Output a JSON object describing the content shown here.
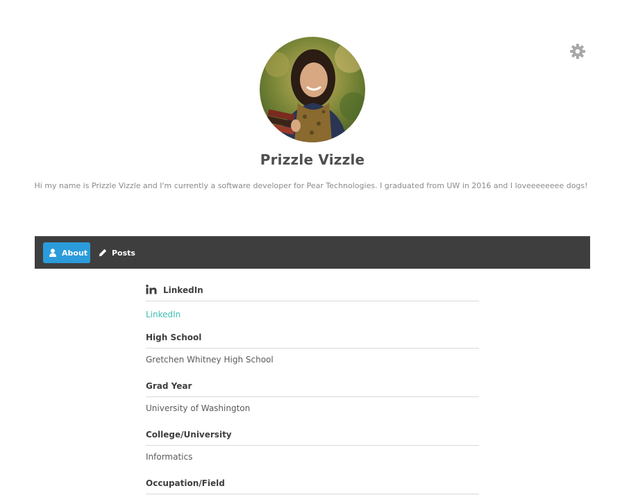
{
  "profile": {
    "name": "Prizzle Vizzle",
    "bio": "Hi my name is Prizzle Vizzle and I'm currently a software developer for Pear Technologies. I graduated from UW in 2016 and I loveeeeeeee dogs!"
  },
  "tabs": {
    "about": "About",
    "posts": "Posts"
  },
  "fields": {
    "linkedin": {
      "label": "LinkedIn",
      "value": "LinkedIn"
    },
    "high_school": {
      "label": "High School",
      "value": "Gretchen Whitney High School"
    },
    "grad_year": {
      "label": "Grad Year",
      "value": "University of Washington"
    },
    "college": {
      "label": "College/University",
      "value": "Informatics"
    },
    "occupation": {
      "label": "Occupation/Field",
      "value": ""
    }
  },
  "icons": {
    "settings": "gear-icon",
    "about_tab": "user-icon",
    "posts_tab": "pencil-icon",
    "linkedin": "linkedin-icon"
  },
  "colors": {
    "accent": "#2b9bdb",
    "tabbar": "#3e3e3e",
    "link": "#3bbfb0"
  }
}
